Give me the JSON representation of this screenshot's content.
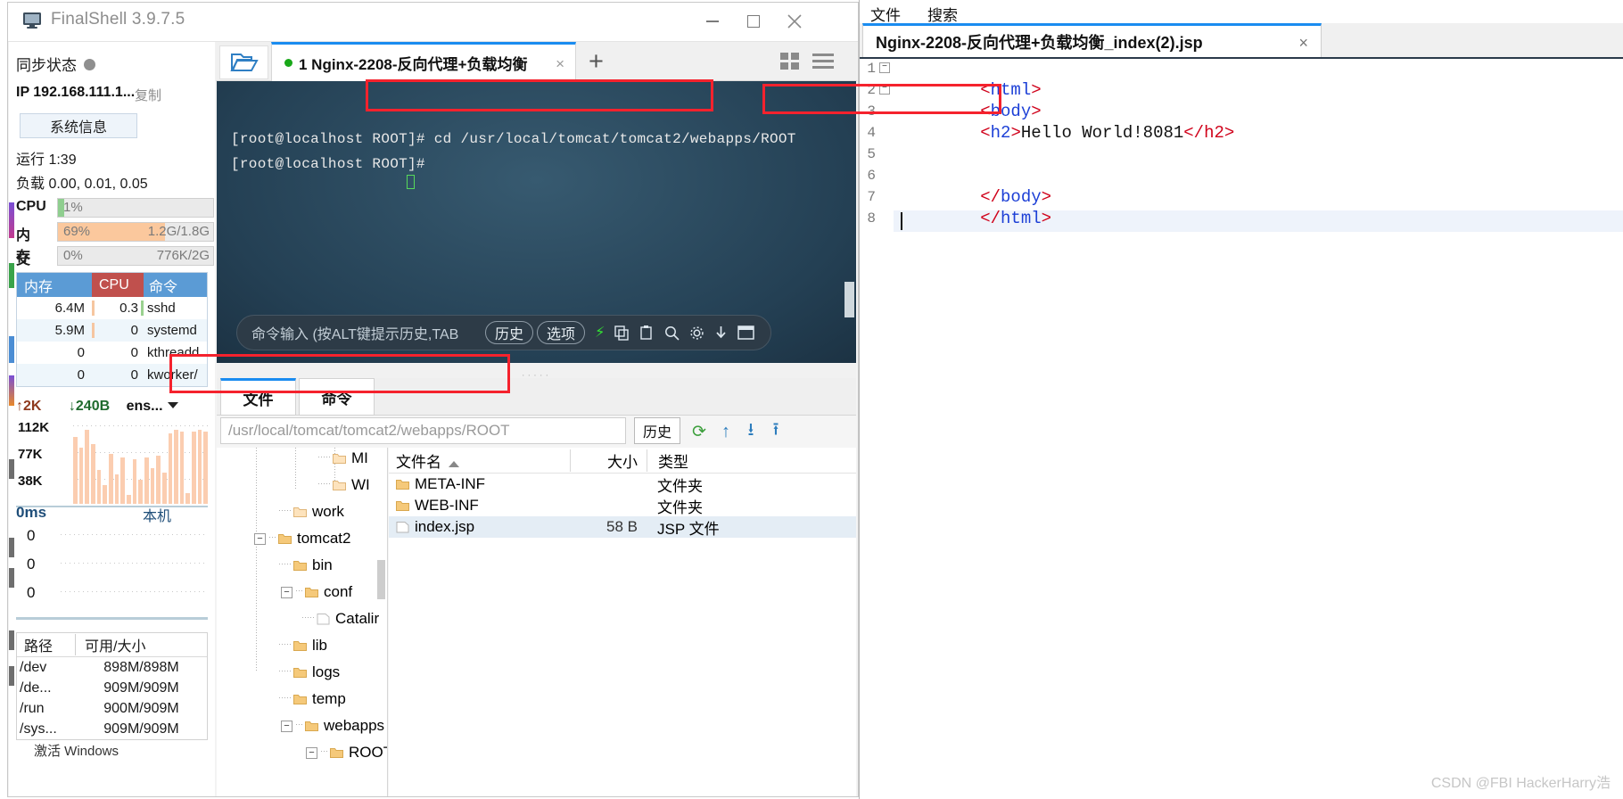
{
  "window": {
    "title": "FinalShell 3.9.7.5",
    "minimize": "minimize-icon",
    "maximize": "maximize-icon",
    "close": "close-icon"
  },
  "sidebar": {
    "sync_label": "同步状态",
    "ip_label": "IP 192.168.111.1...",
    "copy_label": "复制",
    "sysinfo_button": "系统信息",
    "uptime": "运行 1:39",
    "load": "负载 0.00, 0.01, 0.05",
    "meters": [
      {
        "name": "CPU",
        "pct": "1%",
        "value": "",
        "fill": 4,
        "color": "#8fce8f"
      },
      {
        "name": "内存",
        "pct": "69%",
        "value": "1.2G/1.8G",
        "fill": 69,
        "color": "#fbc89d"
      },
      {
        "name": "交换",
        "pct": "0%",
        "value": "776K/2G",
        "fill": 0,
        "color": "#cfcfcf"
      }
    ],
    "proc_headers": [
      "内存",
      "CPU",
      "命令"
    ],
    "proc_rows": [
      {
        "mem": "6.4M",
        "cpu": "0.3",
        "cmd": "sshd"
      },
      {
        "mem": "5.9M",
        "cpu": "0",
        "cmd": "systemd"
      },
      {
        "mem": "0",
        "cpu": "0",
        "cmd": "kthreadd"
      },
      {
        "mem": "0",
        "cpu": "0",
        "cmd": "kworker/"
      }
    ],
    "net": {
      "up": "↑2K",
      "down": "↓240B",
      "iface": "ens...",
      "y_labels": [
        "112K",
        "77K",
        "38K"
      ]
    },
    "ping": {
      "value": "0ms",
      "local": "本机",
      "y_labels": [
        "0",
        "0",
        "0"
      ]
    },
    "disk_headers": [
      "路径",
      "可用/大小"
    ],
    "disk_rows": [
      {
        "path": "/dev",
        "size": "898M/898M"
      },
      {
        "path": "/de...",
        "size": "909M/909M"
      },
      {
        "path": "/run",
        "size": "900M/909M"
      },
      {
        "path": "/sys...",
        "size": "909M/909M"
      }
    ],
    "disk_more": "激活 Windows"
  },
  "terminal": {
    "open_folder_icon": "open-folder-icon",
    "tab_label": "1 Nginx-2208-反向代理+负载均衡",
    "tab_close": "×",
    "tab_add": "+",
    "lines": [
      "[root@localhost ROOT]# cd /usr/local/tomcat/tomcat2/webapps/ROOT",
      "[root@localhost ROOT]#"
    ],
    "line1_prompt": "[root@localhost ROOT]# ",
    "line1_cmd": "cd /usr/local/tomcat/tomcat2/webapps/ROOT",
    "line2_prompt": "[root@localhost ROOT]#",
    "cmdbar": {
      "placeholder": "命令输入 (按ALT键提示历史,TAB",
      "history_chip": "历史",
      "options_chip": "选项",
      "icons": [
        "bolt-icon",
        "copy-icon",
        "paste-icon",
        "search-icon",
        "gear-icon",
        "download-icon",
        "window-icon"
      ]
    }
  },
  "filebrowser": {
    "tabs": [
      "文件",
      "命令"
    ],
    "path": "/usr/local/tomcat/tomcat2/webapps/ROOT",
    "history_button": "历史",
    "toolbar_icons": [
      "refresh-icon",
      "upload-arrow-icon",
      "download-icon",
      "upload-icon"
    ],
    "tree": [
      {
        "label": "MI",
        "depth": 3,
        "expander": ""
      },
      {
        "label": "WI",
        "depth": 3,
        "expander": ""
      },
      {
        "label": "work",
        "depth": 2,
        "expander": ""
      },
      {
        "label": "tomcat2",
        "depth": 1,
        "expander": "−"
      },
      {
        "label": "bin",
        "depth": 2,
        "expander": ""
      },
      {
        "label": "conf",
        "depth": 2,
        "expander": "−"
      },
      {
        "label": "Catalir",
        "depth": 3,
        "expander": ""
      },
      {
        "label": "lib",
        "depth": 2,
        "expander": ""
      },
      {
        "label": "logs",
        "depth": 2,
        "expander": ""
      },
      {
        "label": "temp",
        "depth": 2,
        "expander": ""
      },
      {
        "label": "webapps",
        "depth": 2,
        "expander": "−"
      },
      {
        "label": "ROOT",
        "depth": 3,
        "expander": "−"
      }
    ],
    "list_headers": [
      "文件名",
      "大小",
      "类型"
    ],
    "list_rows": [
      {
        "name": "META-INF",
        "size": "",
        "type": "文件夹",
        "kind": "folder",
        "selected": false
      },
      {
        "name": "WEB-INF",
        "size": "",
        "type": "文件夹",
        "kind": "folder",
        "selected": false
      },
      {
        "name": "index.jsp",
        "size": "58 B",
        "type": "JSP 文件",
        "kind": "file",
        "selected": true
      }
    ]
  },
  "editor": {
    "menu": [
      "文件",
      "搜索"
    ],
    "tab_title": "Nginx-2208-反向代理+负载均衡_index(2).jsp",
    "tab_close": "×",
    "lines": [
      {
        "n": "1",
        "fold": "−",
        "open": "<",
        "tag": "html",
        "close": ">",
        "text": "",
        "end": ""
      },
      {
        "n": "2",
        "fold": "−",
        "open": "<",
        "tag": "body",
        "close": ">",
        "text": "",
        "end": ""
      },
      {
        "n": "3",
        "fold": "",
        "open": "<",
        "tag": "h2",
        "close": ">",
        "text": "Hello World!8081",
        "end": "</h2>"
      },
      {
        "n": "4",
        "fold": "",
        "open": "",
        "tag": "",
        "close": "",
        "text": "",
        "end": ""
      },
      {
        "n": "5",
        "fold": "",
        "open": "",
        "tag": "",
        "close": "",
        "text": "",
        "end": ""
      },
      {
        "n": "6",
        "fold": "",
        "open": "</",
        "tag": "body",
        "close": ">",
        "text": "",
        "end": ""
      },
      {
        "n": "7",
        "fold": "",
        "open": "</",
        "tag": "html",
        "close": ">",
        "text": "",
        "end": ""
      },
      {
        "n": "8",
        "fold": "",
        "open": "",
        "tag": "",
        "close": "",
        "text": "",
        "end": ""
      }
    ]
  },
  "watermark": "CSDN @FBI HackerHarry浩",
  "colors": {
    "accent_blue": "#1a8cf0",
    "annotation_red": "#f5222d",
    "tag_red": "#d0021b",
    "tag_name_blue": "#1c3fd6",
    "terminal_bg": "#244054"
  }
}
